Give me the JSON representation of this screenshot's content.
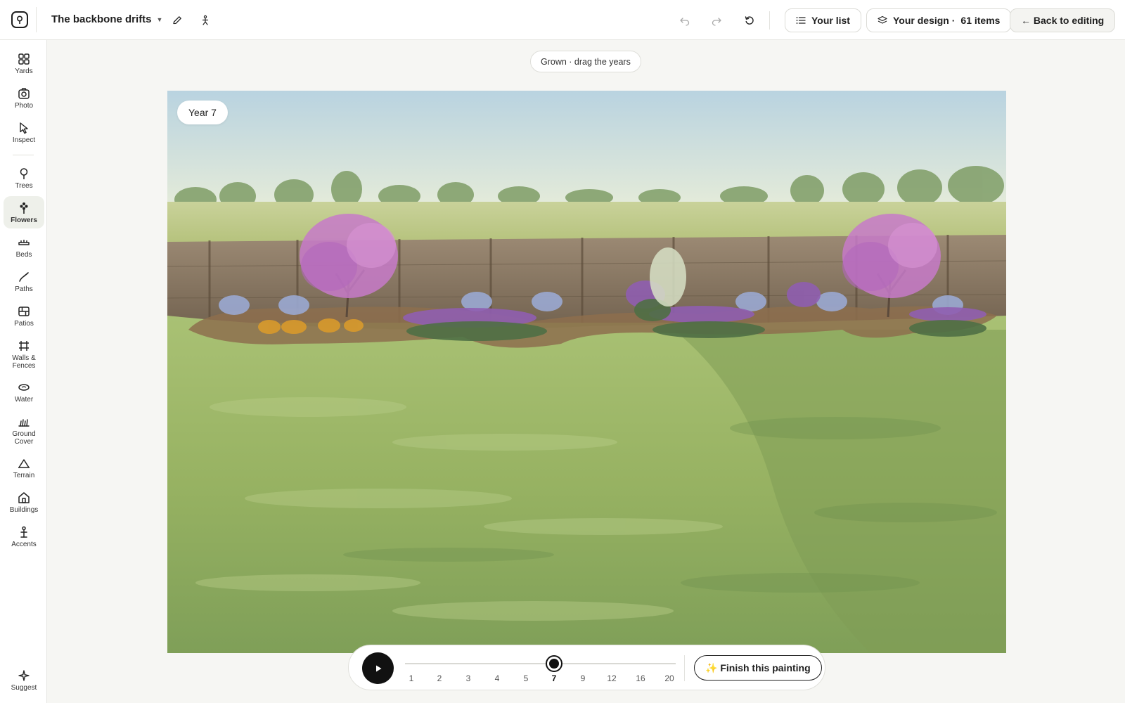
{
  "app": {
    "project_title": "The backbone drifts"
  },
  "header": {
    "your_list_label": "Your list",
    "design_label": "Your design ·",
    "design_count": "61 items",
    "back_label": "← Back to editing"
  },
  "sidebar": {
    "items": [
      {
        "label": "Yards",
        "icon": "grid-icon"
      },
      {
        "label": "Photo",
        "icon": "camera-icon"
      },
      {
        "label": "Inspect",
        "icon": "cursor-icon"
      },
      {
        "label": "Trees",
        "icon": "tree-icon"
      },
      {
        "label": "Flowers",
        "icon": "flower-icon"
      },
      {
        "label": "Beds",
        "icon": "bed-icon"
      },
      {
        "label": "Paths",
        "icon": "path-icon"
      },
      {
        "label": "Patios",
        "icon": "patio-icon"
      },
      {
        "label": "Walls & Fences",
        "icon": "fence-icon"
      },
      {
        "label": "Water",
        "icon": "water-icon"
      },
      {
        "label": "Ground Cover",
        "icon": "ground-cover-icon"
      },
      {
        "label": "Terrain",
        "icon": "terrain-icon"
      },
      {
        "label": "Buildings",
        "icon": "house-icon"
      },
      {
        "label": "Accents",
        "icon": "accent-icon"
      }
    ],
    "active": "Flowers",
    "suggest_label": "Suggest"
  },
  "main": {
    "mode_chip": "Grown · drag the years",
    "year_badge": "Year 7"
  },
  "timeline": {
    "years": [
      "1",
      "2",
      "3",
      "4",
      "5",
      "7",
      "9",
      "12",
      "16",
      "20"
    ],
    "selected_year": "7",
    "finish_label": "✨ Finish this painting"
  },
  "colors": {
    "accent": "#111111",
    "active_nav_bg": "#eef0ea",
    "redbud_bloom": "#c77ac9",
    "lawn": "#8fae5a"
  }
}
